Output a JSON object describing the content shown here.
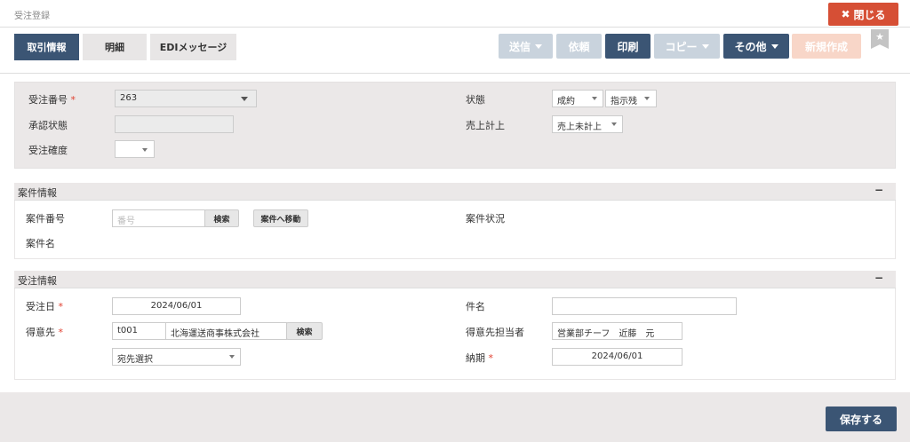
{
  "header": {
    "title": "受注登録",
    "close_label": "閉じる",
    "close_icon": "✖"
  },
  "tabs": [
    {
      "label": "取引情報",
      "active": true
    },
    {
      "label": "明細",
      "active": false
    },
    {
      "label": "EDIメッセージ",
      "active": false
    }
  ],
  "toolbar": {
    "send": "送信",
    "request": "依頼",
    "print": "印刷",
    "copy": "コピー",
    "other": "その他",
    "new": "新規作成",
    "bookmark_icon": "★"
  },
  "summary": {
    "order_no_label": "受注番号",
    "order_no_value": "263",
    "approval_label": "承認状態",
    "approval_value": "",
    "certainty_label": "受注確度",
    "certainty_value": "",
    "status_label": "状態",
    "status_value1": "成約",
    "status_value2": "指示残",
    "sales_label": "売上計上",
    "sales_value": "売上未計上"
  },
  "case_section": {
    "title": "案件情報",
    "collapse": "−",
    "case_no_label": "案件番号",
    "case_no_placeholder": "番号",
    "search_btn": "検索",
    "move_btn": "案件へ移動",
    "case_status_label": "案件状況",
    "case_name_label": "案件名"
  },
  "order_section": {
    "title": "受注情報",
    "collapse": "−",
    "order_date_label": "受注日",
    "order_date_value": "2024/06/01",
    "customer_label": "得意先",
    "customer_code": "t001",
    "customer_name": "北海運送商事株式会社",
    "search_btn": "検索",
    "address_select": "宛先選択",
    "subject_label": "件名",
    "subject_value": "",
    "contact_label": "得意先担当者",
    "contact_value": "営業部チーフ　近藤　元",
    "due_label": "納期",
    "due_value": "2024/06/01"
  },
  "footer": {
    "save_label": "保存する"
  },
  "required_mark": "*"
}
